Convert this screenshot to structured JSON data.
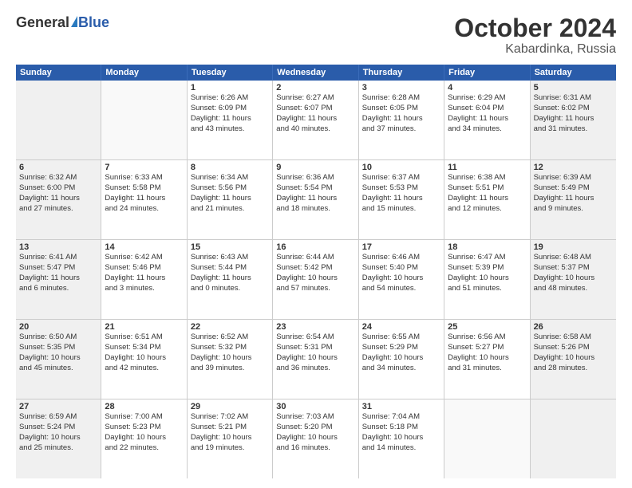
{
  "header": {
    "logo_general": "General",
    "logo_blue": "Blue",
    "month_title": "October 2024",
    "location": "Kabardinka, Russia"
  },
  "days_of_week": [
    "Sunday",
    "Monday",
    "Tuesday",
    "Wednesday",
    "Thursday",
    "Friday",
    "Saturday"
  ],
  "weeks": [
    [
      {
        "day": "",
        "empty": true
      },
      {
        "day": "",
        "empty": true
      },
      {
        "day": "1",
        "lines": [
          "Sunrise: 6:26 AM",
          "Sunset: 6:09 PM",
          "Daylight: 11 hours",
          "and 43 minutes."
        ]
      },
      {
        "day": "2",
        "lines": [
          "Sunrise: 6:27 AM",
          "Sunset: 6:07 PM",
          "Daylight: 11 hours",
          "and 40 minutes."
        ]
      },
      {
        "day": "3",
        "lines": [
          "Sunrise: 6:28 AM",
          "Sunset: 6:05 PM",
          "Daylight: 11 hours",
          "and 37 minutes."
        ]
      },
      {
        "day": "4",
        "lines": [
          "Sunrise: 6:29 AM",
          "Sunset: 6:04 PM",
          "Daylight: 11 hours",
          "and 34 minutes."
        ]
      },
      {
        "day": "5",
        "lines": [
          "Sunrise: 6:31 AM",
          "Sunset: 6:02 PM",
          "Daylight: 11 hours",
          "and 31 minutes."
        ]
      }
    ],
    [
      {
        "day": "6",
        "lines": [
          "Sunrise: 6:32 AM",
          "Sunset: 6:00 PM",
          "Daylight: 11 hours",
          "and 27 minutes."
        ]
      },
      {
        "day": "7",
        "lines": [
          "Sunrise: 6:33 AM",
          "Sunset: 5:58 PM",
          "Daylight: 11 hours",
          "and 24 minutes."
        ]
      },
      {
        "day": "8",
        "lines": [
          "Sunrise: 6:34 AM",
          "Sunset: 5:56 PM",
          "Daylight: 11 hours",
          "and 21 minutes."
        ]
      },
      {
        "day": "9",
        "lines": [
          "Sunrise: 6:36 AM",
          "Sunset: 5:54 PM",
          "Daylight: 11 hours",
          "and 18 minutes."
        ]
      },
      {
        "day": "10",
        "lines": [
          "Sunrise: 6:37 AM",
          "Sunset: 5:53 PM",
          "Daylight: 11 hours",
          "and 15 minutes."
        ]
      },
      {
        "day": "11",
        "lines": [
          "Sunrise: 6:38 AM",
          "Sunset: 5:51 PM",
          "Daylight: 11 hours",
          "and 12 minutes."
        ]
      },
      {
        "day": "12",
        "lines": [
          "Sunrise: 6:39 AM",
          "Sunset: 5:49 PM",
          "Daylight: 11 hours",
          "and 9 minutes."
        ]
      }
    ],
    [
      {
        "day": "13",
        "lines": [
          "Sunrise: 6:41 AM",
          "Sunset: 5:47 PM",
          "Daylight: 11 hours",
          "and 6 minutes."
        ]
      },
      {
        "day": "14",
        "lines": [
          "Sunrise: 6:42 AM",
          "Sunset: 5:46 PM",
          "Daylight: 11 hours",
          "and 3 minutes."
        ]
      },
      {
        "day": "15",
        "lines": [
          "Sunrise: 6:43 AM",
          "Sunset: 5:44 PM",
          "Daylight: 11 hours",
          "and 0 minutes."
        ]
      },
      {
        "day": "16",
        "lines": [
          "Sunrise: 6:44 AM",
          "Sunset: 5:42 PM",
          "Daylight: 10 hours",
          "and 57 minutes."
        ]
      },
      {
        "day": "17",
        "lines": [
          "Sunrise: 6:46 AM",
          "Sunset: 5:40 PM",
          "Daylight: 10 hours",
          "and 54 minutes."
        ]
      },
      {
        "day": "18",
        "lines": [
          "Sunrise: 6:47 AM",
          "Sunset: 5:39 PM",
          "Daylight: 10 hours",
          "and 51 minutes."
        ]
      },
      {
        "day": "19",
        "lines": [
          "Sunrise: 6:48 AM",
          "Sunset: 5:37 PM",
          "Daylight: 10 hours",
          "and 48 minutes."
        ]
      }
    ],
    [
      {
        "day": "20",
        "lines": [
          "Sunrise: 6:50 AM",
          "Sunset: 5:35 PM",
          "Daylight: 10 hours",
          "and 45 minutes."
        ]
      },
      {
        "day": "21",
        "lines": [
          "Sunrise: 6:51 AM",
          "Sunset: 5:34 PM",
          "Daylight: 10 hours",
          "and 42 minutes."
        ]
      },
      {
        "day": "22",
        "lines": [
          "Sunrise: 6:52 AM",
          "Sunset: 5:32 PM",
          "Daylight: 10 hours",
          "and 39 minutes."
        ]
      },
      {
        "day": "23",
        "lines": [
          "Sunrise: 6:54 AM",
          "Sunset: 5:31 PM",
          "Daylight: 10 hours",
          "and 36 minutes."
        ]
      },
      {
        "day": "24",
        "lines": [
          "Sunrise: 6:55 AM",
          "Sunset: 5:29 PM",
          "Daylight: 10 hours",
          "and 34 minutes."
        ]
      },
      {
        "day": "25",
        "lines": [
          "Sunrise: 6:56 AM",
          "Sunset: 5:27 PM",
          "Daylight: 10 hours",
          "and 31 minutes."
        ]
      },
      {
        "day": "26",
        "lines": [
          "Sunrise: 6:58 AM",
          "Sunset: 5:26 PM",
          "Daylight: 10 hours",
          "and 28 minutes."
        ]
      }
    ],
    [
      {
        "day": "27",
        "lines": [
          "Sunrise: 6:59 AM",
          "Sunset: 5:24 PM",
          "Daylight: 10 hours",
          "and 25 minutes."
        ]
      },
      {
        "day": "28",
        "lines": [
          "Sunrise: 7:00 AM",
          "Sunset: 5:23 PM",
          "Daylight: 10 hours",
          "and 22 minutes."
        ]
      },
      {
        "day": "29",
        "lines": [
          "Sunrise: 7:02 AM",
          "Sunset: 5:21 PM",
          "Daylight: 10 hours",
          "and 19 minutes."
        ]
      },
      {
        "day": "30",
        "lines": [
          "Sunrise: 7:03 AM",
          "Sunset: 5:20 PM",
          "Daylight: 10 hours",
          "and 16 minutes."
        ]
      },
      {
        "day": "31",
        "lines": [
          "Sunrise: 7:04 AM",
          "Sunset: 5:18 PM",
          "Daylight: 10 hours",
          "and 14 minutes."
        ]
      },
      {
        "day": "",
        "empty": true
      },
      {
        "day": "",
        "empty": true
      }
    ]
  ]
}
